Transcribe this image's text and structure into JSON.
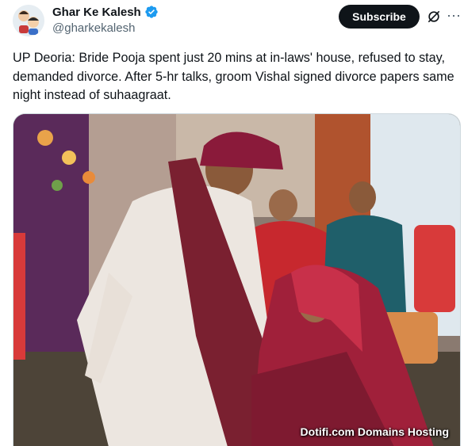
{
  "author": {
    "display_name": "Ghar Ke Kalesh",
    "handle": "@gharkekalesh",
    "verified": true
  },
  "actions": {
    "subscribe_label": "Subscribe",
    "grok_icon": "grok-icon",
    "more_icon": "more-icon"
  },
  "tweet": {
    "text": "UP Deoria: Bride Pooja spent just 20 mins at in-laws' house, refused to stay, demanded divorce. After 5-hr talks, groom Vishal signed divorce papers same night instead of suhaagraat."
  },
  "media": {
    "watermark": "Dotifi.com Domains Hosting"
  },
  "colors": {
    "verified_blue": "#1d9bf0",
    "subscribe_bg": "#0f1419",
    "text_secondary": "#536471"
  }
}
